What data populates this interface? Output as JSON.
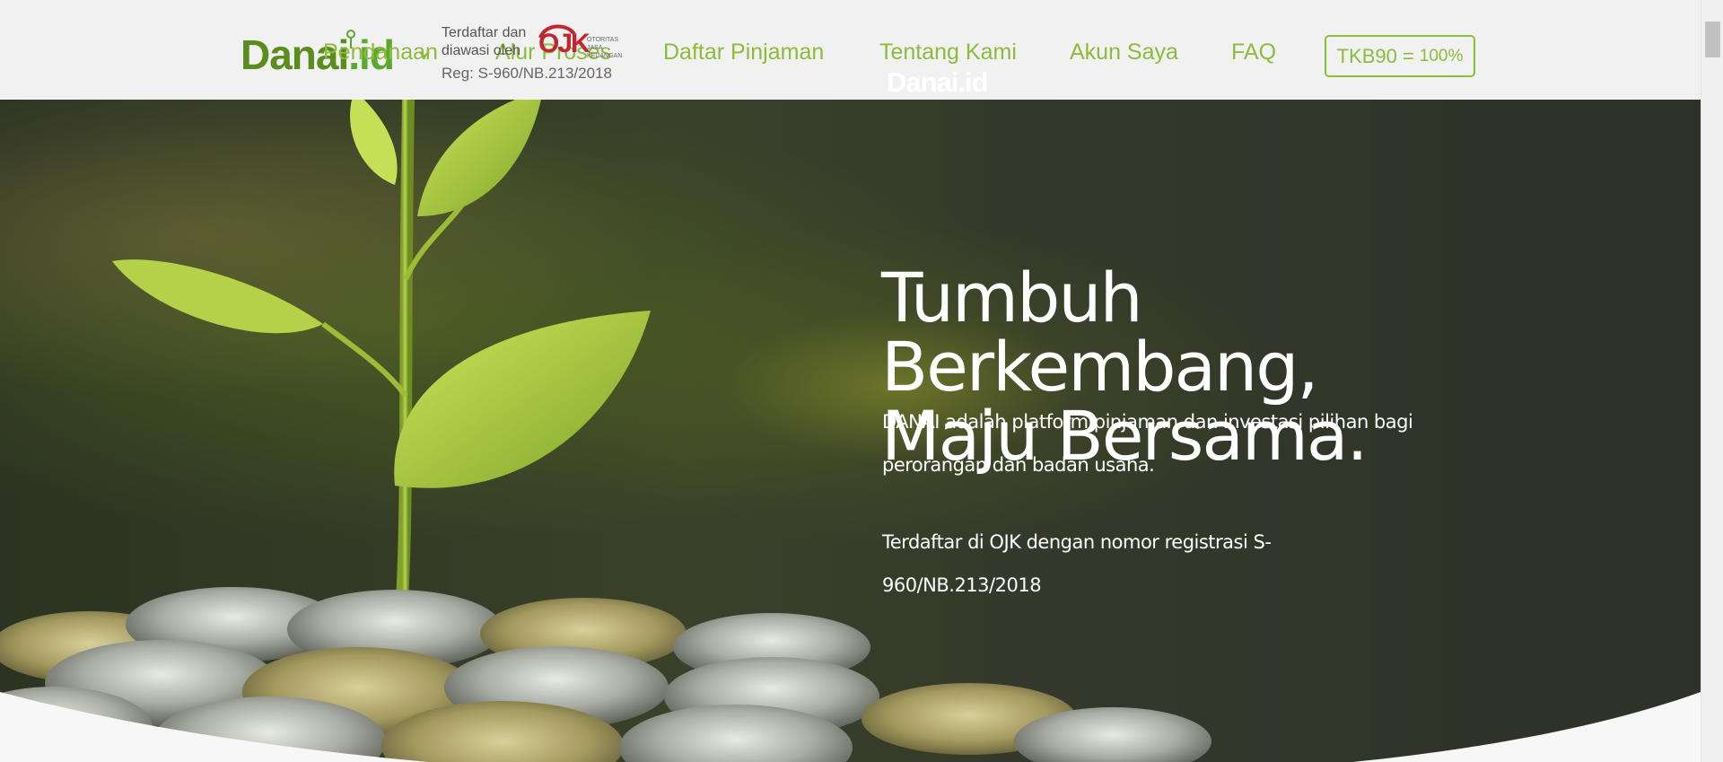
{
  "header": {
    "logo": {
      "text_main": "Danai",
      "text_suffix": ".id"
    },
    "ojk": {
      "line1": "Terdaftar dan",
      "line2": "diawasi oleh",
      "logo_text": "OJK",
      "logo_sub": "OTORITAS JASA KEUANGAN",
      "registration": "Reg: S-960/NB.213/2018"
    },
    "nav": [
      {
        "label": "Pendanaan"
      },
      {
        "label": "Alur Proses"
      },
      {
        "label": "Daftar Pinjaman"
      },
      {
        "label": "Tentang Kami"
      },
      {
        "label": "Akun Saya"
      },
      {
        "label": "FAQ"
      }
    ],
    "tkb": {
      "label": "TKB90 =",
      "value": "100%"
    },
    "overlay_logo": "Danai.id"
  },
  "hero": {
    "headline": [
      "Tumbuh",
      "Berkembang,",
      "Maju Bersama."
    ],
    "description": "DANAI adalah platform pinjaman dan investasi pilihan bagi perorangan dan badan usaha.",
    "registration_note": "Terdaftar di OJK dengan nomor registrasi S-960/NB.213/2018"
  },
  "colors": {
    "brand_green": "#5a8c1e",
    "nav_green": "#8dbb3c",
    "ojk_red": "#c3262e",
    "header_bg": "#f1f1f1"
  },
  "icons": [
    "leaf-icon",
    "chevron-down-icon",
    "ojk-logo"
  ]
}
